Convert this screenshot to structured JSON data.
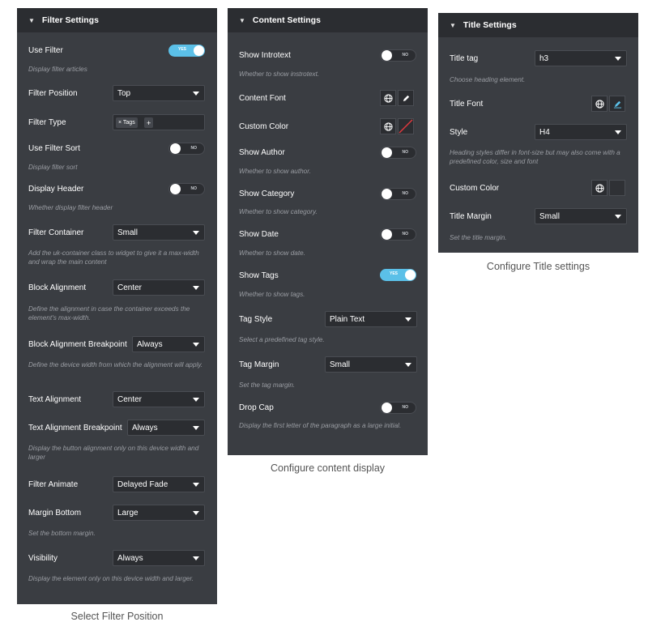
{
  "filter_panel": {
    "title": "Filter Settings",
    "use_filter": {
      "label": "Use Filter",
      "toggle": "YES",
      "desc": "Display filter articles"
    },
    "filter_position": {
      "label": "Filter Position",
      "value": "Top"
    },
    "filter_type": {
      "label": "Filter Type",
      "tag": "× Tags",
      "add": "+"
    },
    "use_filter_sort": {
      "label": "Use Filter Sort",
      "toggle": "NO",
      "desc": "Display filter sort"
    },
    "display_header": {
      "label": "Display Header",
      "toggle": "NO",
      "desc": "Whether display filter header"
    },
    "filter_container": {
      "label": "Filter Container",
      "value": "Small",
      "desc": "Add the uk-container class to widget to give it a max-width and wrap the main content"
    },
    "block_alignment": {
      "label": "Block Alignment",
      "value": "Center",
      "desc": "Define the alignment in case the container exceeds the element's max-width."
    },
    "block_alignment_breakpoint": {
      "label": "Block Alignment Breakpoint",
      "value": "Always",
      "desc": "Define the device width from which the alignment will apply."
    },
    "text_alignment": {
      "label": "Text Alignment",
      "value": "Center"
    },
    "text_alignment_breakpoint": {
      "label": "Text Alignment Breakpoint",
      "value": "Always",
      "desc": "Display the button alignment only on this device width and larger"
    },
    "filter_animate": {
      "label": "Filter Animate",
      "value": "Delayed Fade"
    },
    "margin_bottom": {
      "label": "Margin Bottom",
      "value": "Large",
      "desc": "Set the bottom margin."
    },
    "visibility": {
      "label": "Visibility",
      "value": "Always",
      "desc": "Display the element only on this device width and larger."
    },
    "caption": "Select Filter Position"
  },
  "content_panel": {
    "title": "Content Settings",
    "show_introtext": {
      "label": "Show Introtext",
      "toggle": "NO",
      "desc": "Whether to show instrotext."
    },
    "content_font": {
      "label": "Content Font"
    },
    "custom_color": {
      "label": "Custom Color"
    },
    "show_author": {
      "label": "Show Author",
      "toggle": "NO",
      "desc": "Whether to show author."
    },
    "show_category": {
      "label": "Show Category",
      "toggle": "NO",
      "desc": "Whether to show category."
    },
    "show_date": {
      "label": "Show Date",
      "toggle": "NO",
      "desc": "Whether to show date."
    },
    "show_tags": {
      "label": "Show Tags",
      "toggle": "YES",
      "desc": "Whether to show tags."
    },
    "tag_style": {
      "label": "Tag Style",
      "value": "Plain Text",
      "desc": "Select a predefined tag style."
    },
    "tag_margin": {
      "label": "Tag Margin",
      "value": "Small",
      "desc": "Set the tag margin."
    },
    "drop_cap": {
      "label": "Drop Cap",
      "toggle": "NO",
      "desc": "Display the first letter of the paragraph as a large initial."
    },
    "caption": "Configure content display"
  },
  "title_panel": {
    "title": "Title Settings",
    "title_tag": {
      "label": "Title tag",
      "value": "h3",
      "desc": "Choose heading element."
    },
    "title_font": {
      "label": "Title Font"
    },
    "style": {
      "label": "Style",
      "value": "H4",
      "desc": "Heading styles differ in font-size but may also come with a predefined color, size and font"
    },
    "custom_color": {
      "label": "Custom Color"
    },
    "title_margin": {
      "label": "Title Margin",
      "value": "Small",
      "desc": "Set the title margin."
    },
    "caption": "Configure Title settings"
  },
  "colors": {
    "panel": "#3a3d42",
    "header": "#2b2d31",
    "toggle_on": "#5bc0e8",
    "accent_red": "#e0393e",
    "accent_blue": "#5bc0e8"
  }
}
